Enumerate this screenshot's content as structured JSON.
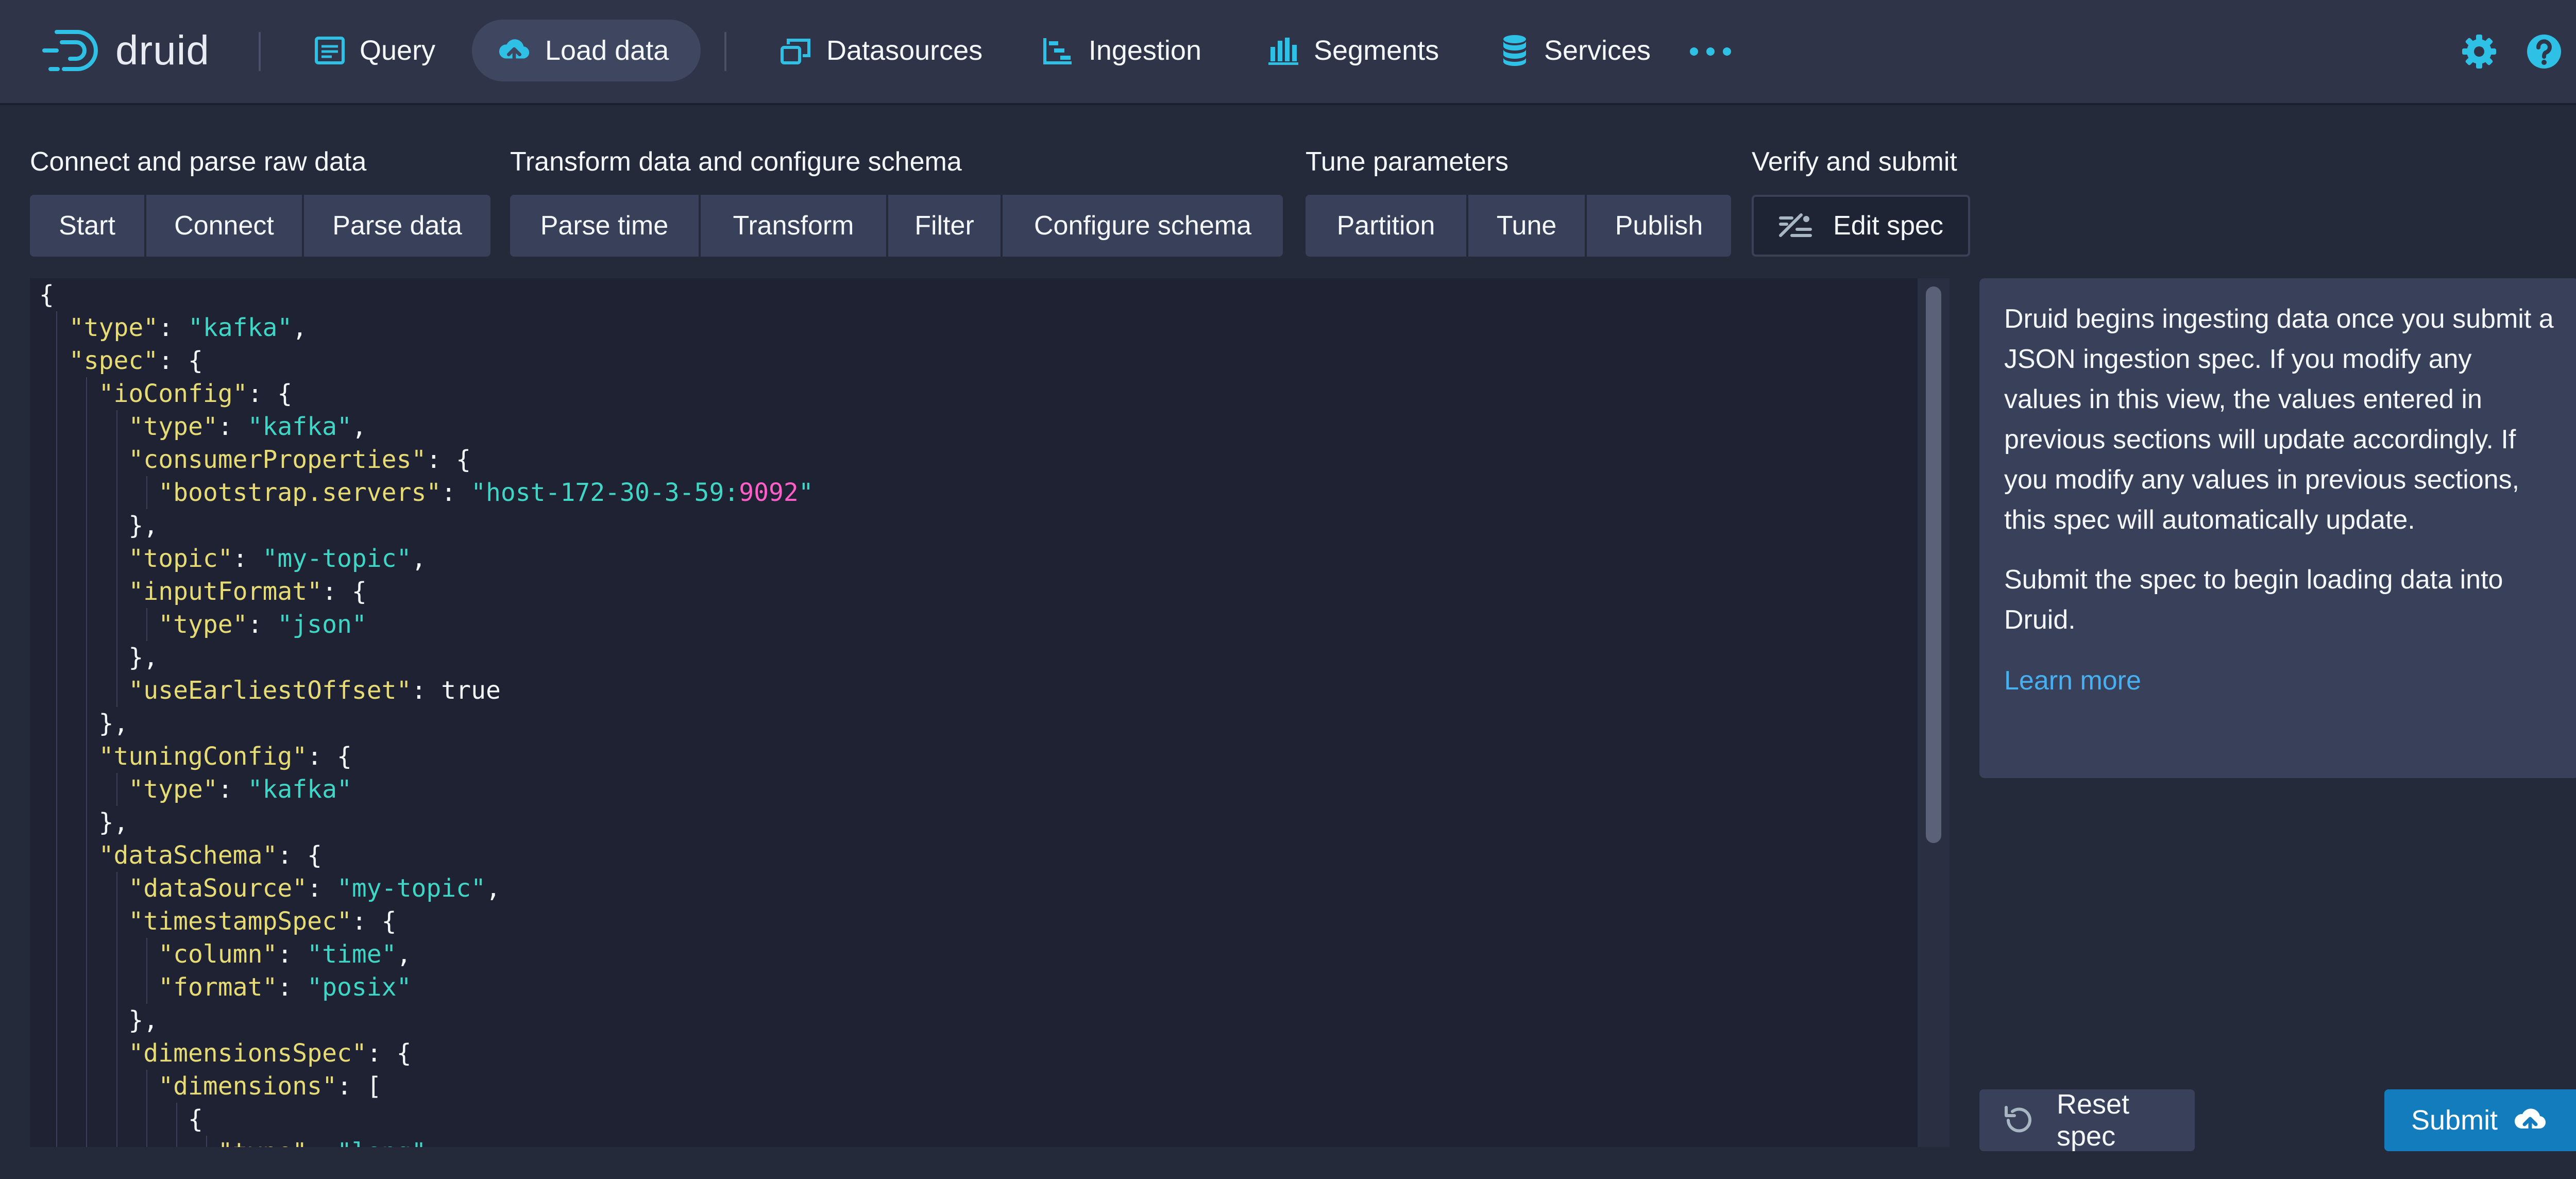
{
  "app": {
    "logo_text": "druid"
  },
  "nav": {
    "items": [
      {
        "label": "Query",
        "icon": "query-icon",
        "active": false
      },
      {
        "label": "Load data",
        "icon": "cloud-upload-icon",
        "active": true
      },
      {
        "label": "Datasources",
        "icon": "multi-select-icon",
        "active": false
      },
      {
        "label": "Ingestion",
        "icon": "gantt-chart-icon",
        "active": false
      },
      {
        "label": "Segments",
        "icon": "stacked-chart-icon",
        "active": false
      },
      {
        "label": "Services",
        "icon": "database-icon",
        "active": false
      }
    ],
    "more_icon": "more-icon",
    "settings_icon": "gear-icon",
    "help_icon": "help-icon",
    "accent_color": "#2ec1e5"
  },
  "steps": [
    {
      "title": "Connect and parse raw data",
      "buttons": [
        "Start",
        "Connect",
        "Parse data"
      ]
    },
    {
      "title": "Transform data and configure schema",
      "buttons": [
        "Parse time",
        "Transform",
        "Filter",
        "Configure schema"
      ]
    },
    {
      "title": "Tune parameters",
      "buttons": [
        "Partition",
        "Tune",
        "Publish"
      ]
    },
    {
      "title": "Verify and submit",
      "buttons": [
        "Edit spec"
      ],
      "active": "Edit spec"
    }
  ],
  "editor": {
    "lines": [
      "{",
      "  \"type\": \"kafka\",",
      "  \"spec\": {",
      "    \"ioConfig\": {",
      "      \"type\": \"kafka\",",
      "      \"consumerProperties\": {",
      "        \"bootstrap.servers\": \"host-172-30-3-59:9092\"",
      "      },",
      "      \"topic\": \"my-topic\",",
      "      \"inputFormat\": {",
      "        \"type\": \"json\"",
      "      },",
      "      \"useEarliestOffset\": true",
      "    },",
      "    \"tuningConfig\": {",
      "      \"type\": \"kafka\"",
      "    },",
      "    \"dataSchema\": {",
      "      \"dataSource\": \"my-topic\",",
      "      \"timestampSpec\": {",
      "        \"column\": \"time\",",
      "        \"format\": \"posix\"",
      "      },",
      "      \"dimensionsSpec\": {",
      "        \"dimensions\": [",
      "          {",
      "            \"type\": \"long\","
    ]
  },
  "sidebar": {
    "paragraph1": "Druid begins ingesting data once you submit a JSON ingestion spec. If you modify any values in this view, the values entered in previous sections will update accordingly. If you modify any values in previous sections, this spec will automatically update.",
    "paragraph2": "Submit the spec to begin loading data into Druid.",
    "learn_more": "Learn more"
  },
  "actions": {
    "reset_label": "Reset spec",
    "submit_label": "Submit"
  },
  "colors": {
    "json_key": "#e6db74",
    "json_string": "#3fd6c6",
    "json_number": "#ff5ec8",
    "primary": "#137cbd",
    "link": "#48aff0"
  }
}
